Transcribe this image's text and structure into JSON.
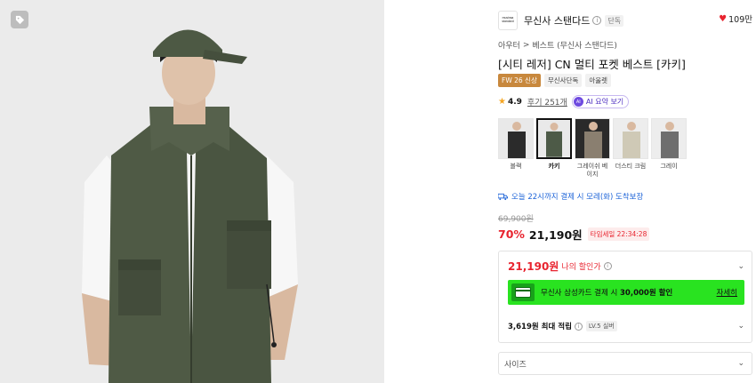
{
  "product": {
    "brand_logo_text": "musinsa standard",
    "brand_name": "무신사 스탠다드",
    "brand_badge": "단독",
    "likes": "109만",
    "breadcrumb": [
      "아우터",
      ">",
      "베스트 (무신사 스탠다드)"
    ],
    "title": "[시티 레저] CN 멀티 포켓 베스트 [카키]",
    "badges": [
      "FW 26 신상",
      "무신사단독",
      "아울렛"
    ],
    "rating": "4.9",
    "reviews": "후기 251개",
    "ai_badge": "AI",
    "ai_label": "AI 요약 보기"
  },
  "swatches": [
    {
      "label": "블랙",
      "color": "#2b2b2b",
      "selected": false
    },
    {
      "label": "카키",
      "color": "#4d5a47",
      "selected": true
    },
    {
      "label": "그레이쉬 베이지",
      "color": "#8a7f70",
      "selected": false
    },
    {
      "label": "더스티 크림",
      "color": "#cfc9b6",
      "selected": false
    },
    {
      "label": "그레이",
      "color": "#6e6e6e",
      "selected": false
    }
  ],
  "delivery": "오늘 22시까지 결제 시 모레(화) 도착보장",
  "price": {
    "original": "69,900원",
    "discount": "70%",
    "final": "21,190원",
    "timesale": "타임세일 22:34:28"
  },
  "my_discount": {
    "price": "21,190원",
    "label": "나의 할인가"
  },
  "card_promo": {
    "text_prefix": "무신사 삼성카드 결제 시 ",
    "amount": "30,000원 할인",
    "link": "자세히",
    "color": "#29e320"
  },
  "points": {
    "text": "3,619원 최대 적립",
    "level": "LV.5 실버"
  },
  "size_select": {
    "placeholder": "사이즈"
  },
  "colors": {
    "accent_red": "#e8242f",
    "delivery_blue": "#1e64d8",
    "badge_orange": "#c8883d"
  }
}
